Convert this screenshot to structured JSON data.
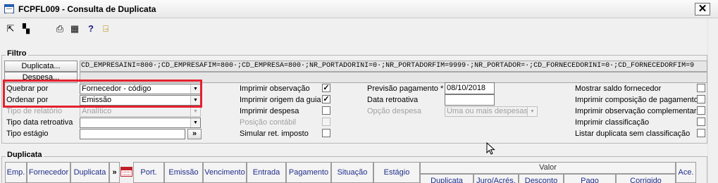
{
  "window": {
    "title": "FCPFL009 - Consulta de Duplicata",
    "close_label": "✕"
  },
  "toolbar": {
    "icons": [
      "move-icon",
      "arrange-icon",
      "print-icon",
      "calculator-icon",
      "help-icon",
      "exit-icon"
    ],
    "glyphs": {
      "move": "⇱",
      "arrange": "▚",
      "print": "⎙",
      "calc": "▦",
      "help": "?",
      "exit": "⍈"
    }
  },
  "filtro": {
    "title": "Filtro",
    "duplicata_button": "Duplicata...",
    "despesa_button": "Despesa...",
    "duplicata_filter_text": "CD_EMPRESAINI=800·;CD_EMPRESAFIM=800·;CD_EMPRESA=800·;NR_PORTADORINI=0·;NR_PORTADORFIM=9999·;NR_PORTADOR=·;CD_FORNECEDORINI=0·;CD_FORNECEDORFIM=9",
    "despesa_filter_text": "",
    "quebrar_por_label": "Quebrar por",
    "quebrar_por_value": "Fornecedor - código",
    "ordenar_por_label": "Ordenar por",
    "ordenar_por_value": "Emissão",
    "tipo_relatorio_label": "Tipo de relatório",
    "tipo_relatorio_value": "Analítico",
    "tipo_data_retroativa_label": "Tipo data retroativa",
    "tipo_data_retroativa_value": "",
    "tipo_estagio_label": "Tipo estágio",
    "tipo_estagio_value": "",
    "tipo_estagio_button": "»",
    "imprimir_observacao_label": "Imprimir observação",
    "imprimir_observacao_checked": "✓",
    "imprimir_origem_guia_label": "Imprimir origem da guia",
    "imprimir_origem_guia_checked": "✓",
    "imprimir_despesa_label": "Imprimir despesa",
    "posicao_contabil_label": "Posição contábil",
    "simular_ret_imposto_label": "Simular ret. imposto",
    "previsao_pagamento_label": "Previsão pagamento *",
    "previsao_pagamento_value": "08/10/2018",
    "data_retroativa_label": "Data retroativa",
    "data_retroativa_value": "",
    "opcao_despesa_label": "Opção despesa",
    "opcao_despesa_value": "Uma ou mais despesas",
    "mostrar_saldo_label": "Mostrar saldo fornecedor",
    "imprimir_composicao_label": "Imprimir composição de pagamento",
    "imprimir_obs_complementar_label": "Imprimir observação complementar",
    "imprimir_classificacao_label": "Imprimir classificação",
    "listar_sem_classificacao_label": "Listar duplicata sem classificação"
  },
  "duplicata": {
    "title": "Duplicata",
    "columns": {
      "emp": "Emp.",
      "fornecedor": "Fornecedor",
      "duplicata": "Duplicata",
      "expand": "»",
      "port": "Port.",
      "emissao": "Emissão",
      "vencimento": "Vencimento",
      "entrada": "Entrada",
      "pagamento": "Pagamento",
      "situacao": "Situação",
      "estagio": "Estágio",
      "valor": "Valor",
      "valor_duplicata": "Duplicata",
      "valor_juro": "Juro/Acrés.",
      "valor_desconto": "Desconto",
      "valor_pago": "Pago",
      "valor_corrigido": "Corrigido",
      "ace": "Ace."
    }
  },
  "colors": {
    "highlight": "#e5202e",
    "header_text": "#1f2d8a"
  }
}
